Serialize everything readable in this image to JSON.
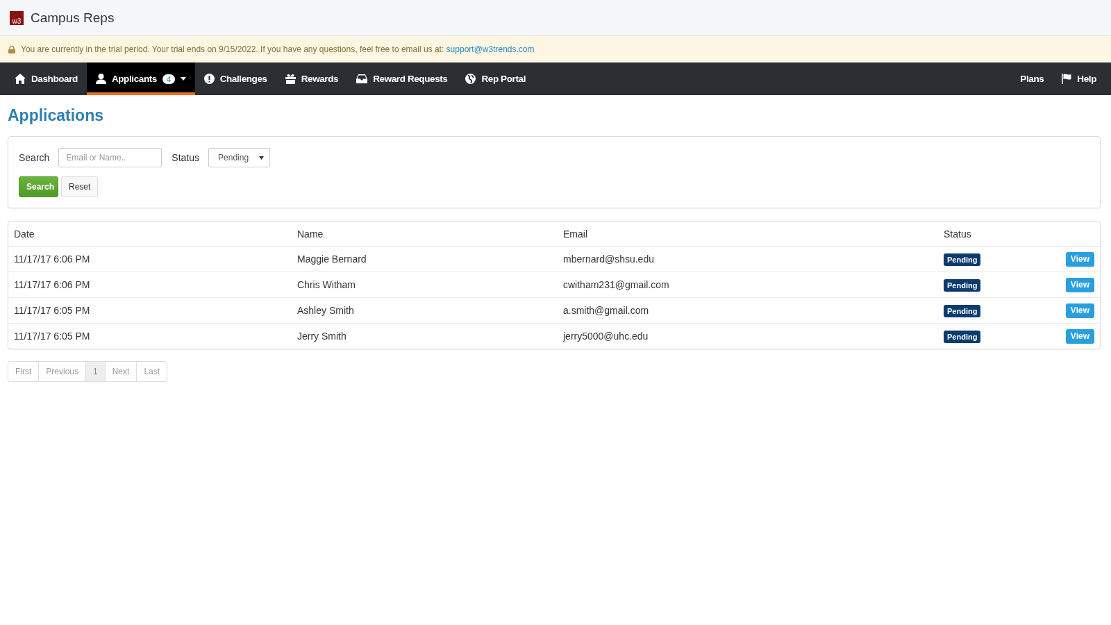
{
  "header": {
    "logo_text": "w3",
    "title": "Campus Reps"
  },
  "banner": {
    "text": "You are currently in the trial period. Your trial ends on 9/15/2022. If you have any questions, feel free to email us at:",
    "link": "support@w3trends.com"
  },
  "nav": {
    "items": [
      {
        "label": "Dashboard",
        "selected": false
      },
      {
        "label": "Applicants",
        "selected": true,
        "badge": "4",
        "dropdown": true
      },
      {
        "label": "Challenges",
        "selected": false
      },
      {
        "label": "Rewards",
        "selected": false
      },
      {
        "label": "Reward Requests",
        "selected": false
      },
      {
        "label": "Rep Portal",
        "selected": false
      }
    ],
    "right_items": [
      {
        "label": "Plans",
        "icon": false
      },
      {
        "label": "Help",
        "icon": true
      }
    ]
  },
  "page_title": "Applications",
  "filters": {
    "search_label": "Search",
    "search_placeholder": "Email or Name..",
    "status_label": "Status",
    "status_value": "Pending",
    "buttons": [
      {
        "label": "Search",
        "kind": "primary"
      },
      {
        "label": "Reset",
        "kind": "default"
      }
    ]
  },
  "table": {
    "columns": [
      "Date",
      "Name",
      "Email",
      "Status"
    ],
    "rows": [
      {
        "date": "11/17/17 6:06 PM",
        "name": "Maggie Bernard",
        "email": "mbernard@shsu.edu",
        "status": "Pending",
        "action": "View"
      },
      {
        "date": "11/17/17 6:06 PM",
        "name": "Chris Witham",
        "email": "cwitham231@gmail.com",
        "status": "Pending",
        "action": "View"
      },
      {
        "date": "11/17/17 6:05 PM",
        "name": "Ashley Smith",
        "email": "a.smith@gmail.com",
        "status": "Pending",
        "action": "View"
      },
      {
        "date": "11/17/17 6:05 PM",
        "name": "Jerry Smith",
        "email": "jerry5000@uhc.edu",
        "status": "Pending",
        "action": "View"
      }
    ]
  },
  "pagination": [
    {
      "label": "First",
      "selected": false,
      "disabled": true
    },
    {
      "label": "Previous",
      "selected": false,
      "disabled": true
    },
    {
      "label": "1",
      "selected": true,
      "disabled": false
    },
    {
      "label": "Next",
      "selected": false,
      "disabled": true
    },
    {
      "label": "Last",
      "selected": false,
      "disabled": true
    }
  ]
}
